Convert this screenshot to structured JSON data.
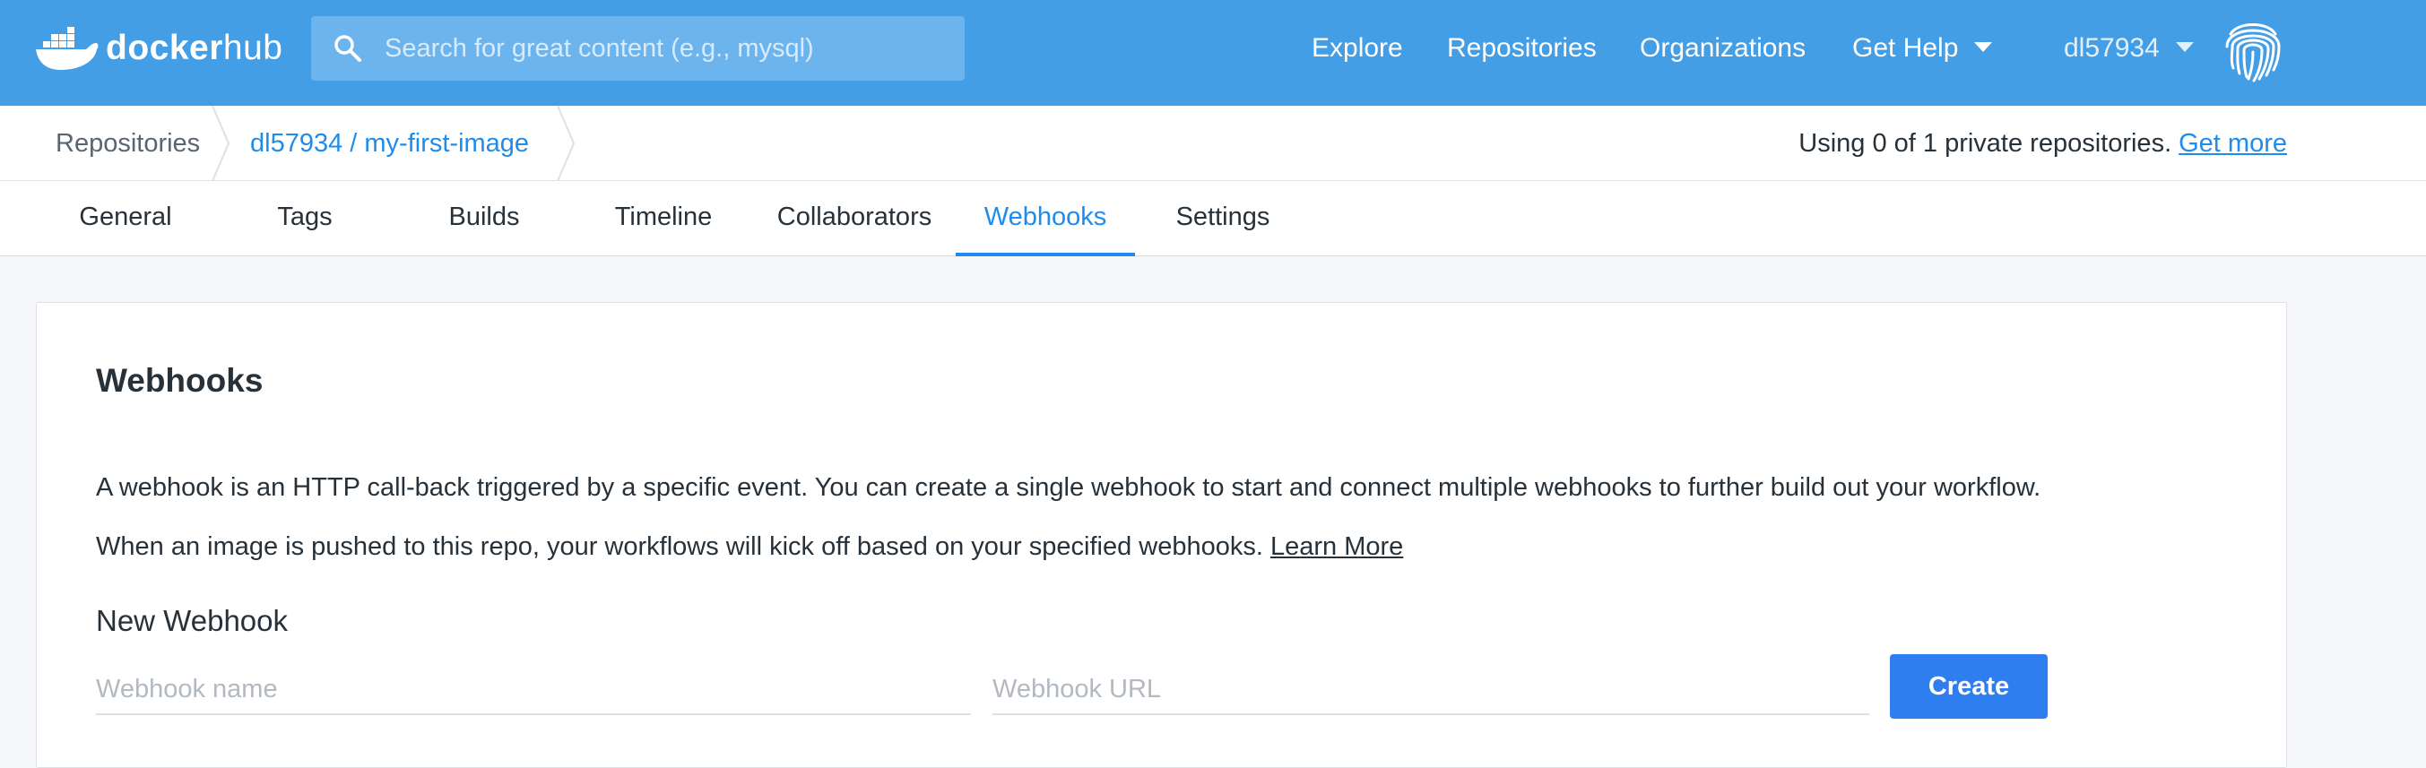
{
  "header": {
    "logo": {
      "word1": "docker",
      "word2": "hub",
      "icon": "docker-whale-icon"
    },
    "search": {
      "placeholder": "Search for great content (e.g., mysql)",
      "value": "",
      "icon": "search-icon"
    },
    "nav": {
      "explore": "Explore",
      "repositories": "Repositories",
      "organizations": "Organizations",
      "get_help": "Get Help"
    },
    "user": {
      "name": "dl57934",
      "avatar_icon": "fingerprint-icon"
    }
  },
  "breadcrumb": {
    "items": [
      "Repositories",
      "dl57934 / my-first-image"
    ]
  },
  "usage": {
    "text": "Using 0 of 1 private repositories.",
    "link": "Get more"
  },
  "tabs": [
    {
      "label": "General",
      "active": false
    },
    {
      "label": "Tags",
      "active": false
    },
    {
      "label": "Builds",
      "active": false
    },
    {
      "label": "Timeline",
      "active": false
    },
    {
      "label": "Collaborators",
      "active": false
    },
    {
      "label": "Webhooks",
      "active": true
    },
    {
      "label": "Settings",
      "active": false
    }
  ],
  "card": {
    "title": "Webhooks",
    "description1": "A webhook is an HTTP call-back triggered by a specific event. You can create a single webhook to start and connect multiple webhooks to further build out your workflow.",
    "description2": "When an image is pushed to this repo, your workflows will kick off based on your specified webhooks.",
    "learn_more": "Learn More",
    "new_webhook": {
      "title": "New Webhook",
      "name_placeholder": "Webhook name",
      "url_placeholder": "Webhook URL",
      "name_value": "",
      "url_value": "",
      "create_label": "Create"
    }
  },
  "colors": {
    "header_bg": "#439ee6",
    "accent": "#1f8ceb",
    "button": "#2e7ef0",
    "page_bg": "#f5f6f8"
  }
}
